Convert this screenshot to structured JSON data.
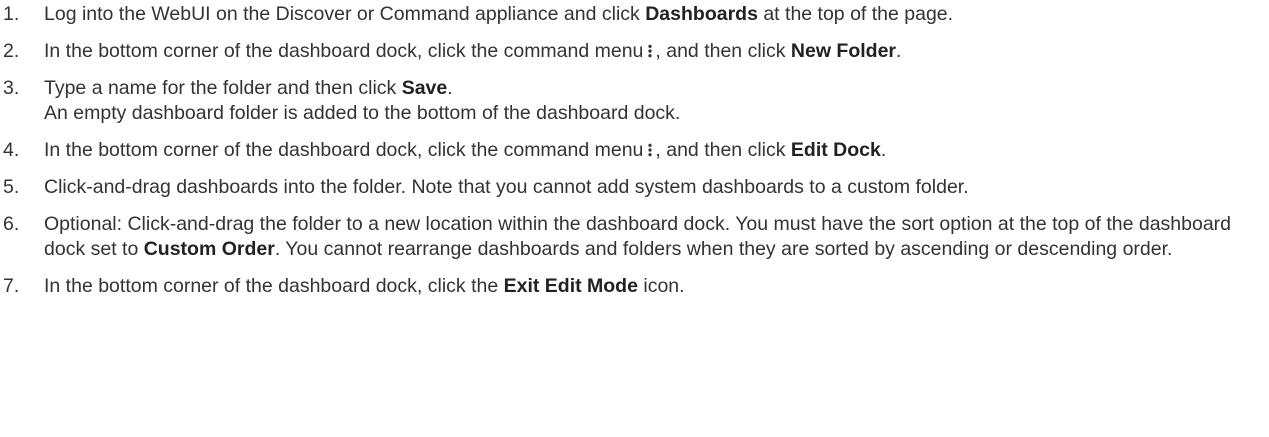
{
  "steps": [
    {
      "number": "1.",
      "pre": "Log into the WebUI on the Discover or Command appliance and click ",
      "bold": "Dashboards",
      "post": " at the top of the page."
    },
    {
      "number": "2.",
      "pre": "In the bottom corner of the dashboard dock, click the command menu",
      "icon": "kebab-menu-icon",
      "mid": ", and then click ",
      "bold": "New Folder",
      "post": "."
    },
    {
      "number": "3.",
      "pre": "Type a name for the folder and then click ",
      "bold": "Save",
      "post": ".",
      "sub": "An empty dashboard folder is added to the bottom of the dashboard dock."
    },
    {
      "number": "4.",
      "pre": "In the bottom corner of the dashboard dock, click the command menu",
      "icon": "kebab-menu-icon",
      "mid": ", and then click ",
      "bold": "Edit Dock",
      "post": "."
    },
    {
      "number": "5.",
      "text": "Click-and-drag dashboards into the folder. Note that you cannot add system dashboards to a custom folder."
    },
    {
      "number": "6.",
      "pre": "Optional: Click-and-drag the folder to a new location within the dashboard dock. You must have the sort option at the top of the dashboard dock set to ",
      "bold": "Custom Order",
      "post": ". You cannot rearrange dashboards and folders when they are sorted by ascending or descending order."
    },
    {
      "number": "7.",
      "pre": "In the bottom corner of the dashboard dock, click the ",
      "bold": "Exit Edit Mode",
      "post": " icon."
    }
  ]
}
